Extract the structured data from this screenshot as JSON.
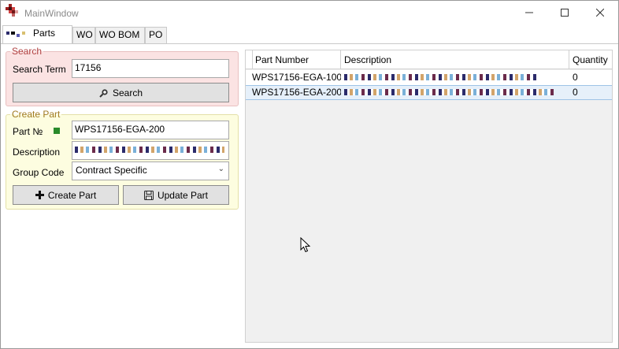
{
  "window": {
    "title": "MainWindow"
  },
  "tabs": [
    {
      "label": "Parts",
      "active": true
    },
    {
      "label": "WO",
      "active": false
    },
    {
      "label": "WO BOM",
      "active": false
    },
    {
      "label": "PO",
      "active": false
    }
  ],
  "search": {
    "legend": "Search",
    "term_label": "Search Term",
    "term_value": "17156",
    "button_label": "Search",
    "button_icon": "magnifier-icon"
  },
  "create_part": {
    "legend": "Create Part",
    "part_no_label": "Part №",
    "part_no_value": "WPS17156-EGA-200",
    "description_label": "Description",
    "group_code_label": "Group Code",
    "group_code_value": "Contract Specific",
    "create_button_label": "Create Part",
    "create_button_icon": "plus-icon",
    "update_button_label": "Update Part",
    "update_button_icon": "save-icon",
    "status_color": "#2a8a2a"
  },
  "grid": {
    "columns": [
      "Part Number",
      "Description",
      "Quantity"
    ],
    "rows": [
      {
        "part_number": "WPS17156-EGA-100",
        "quantity": "0",
        "selected": false
      },
      {
        "part_number": "WPS17156-EGA-200",
        "quantity": "0",
        "selected": true
      }
    ]
  },
  "colors": {
    "search_bg": "#fbe3e3",
    "search_legend": "#b04040",
    "create_bg": "#fdfde0",
    "create_legend": "#a07a20",
    "selection": "#e6f0fa"
  }
}
